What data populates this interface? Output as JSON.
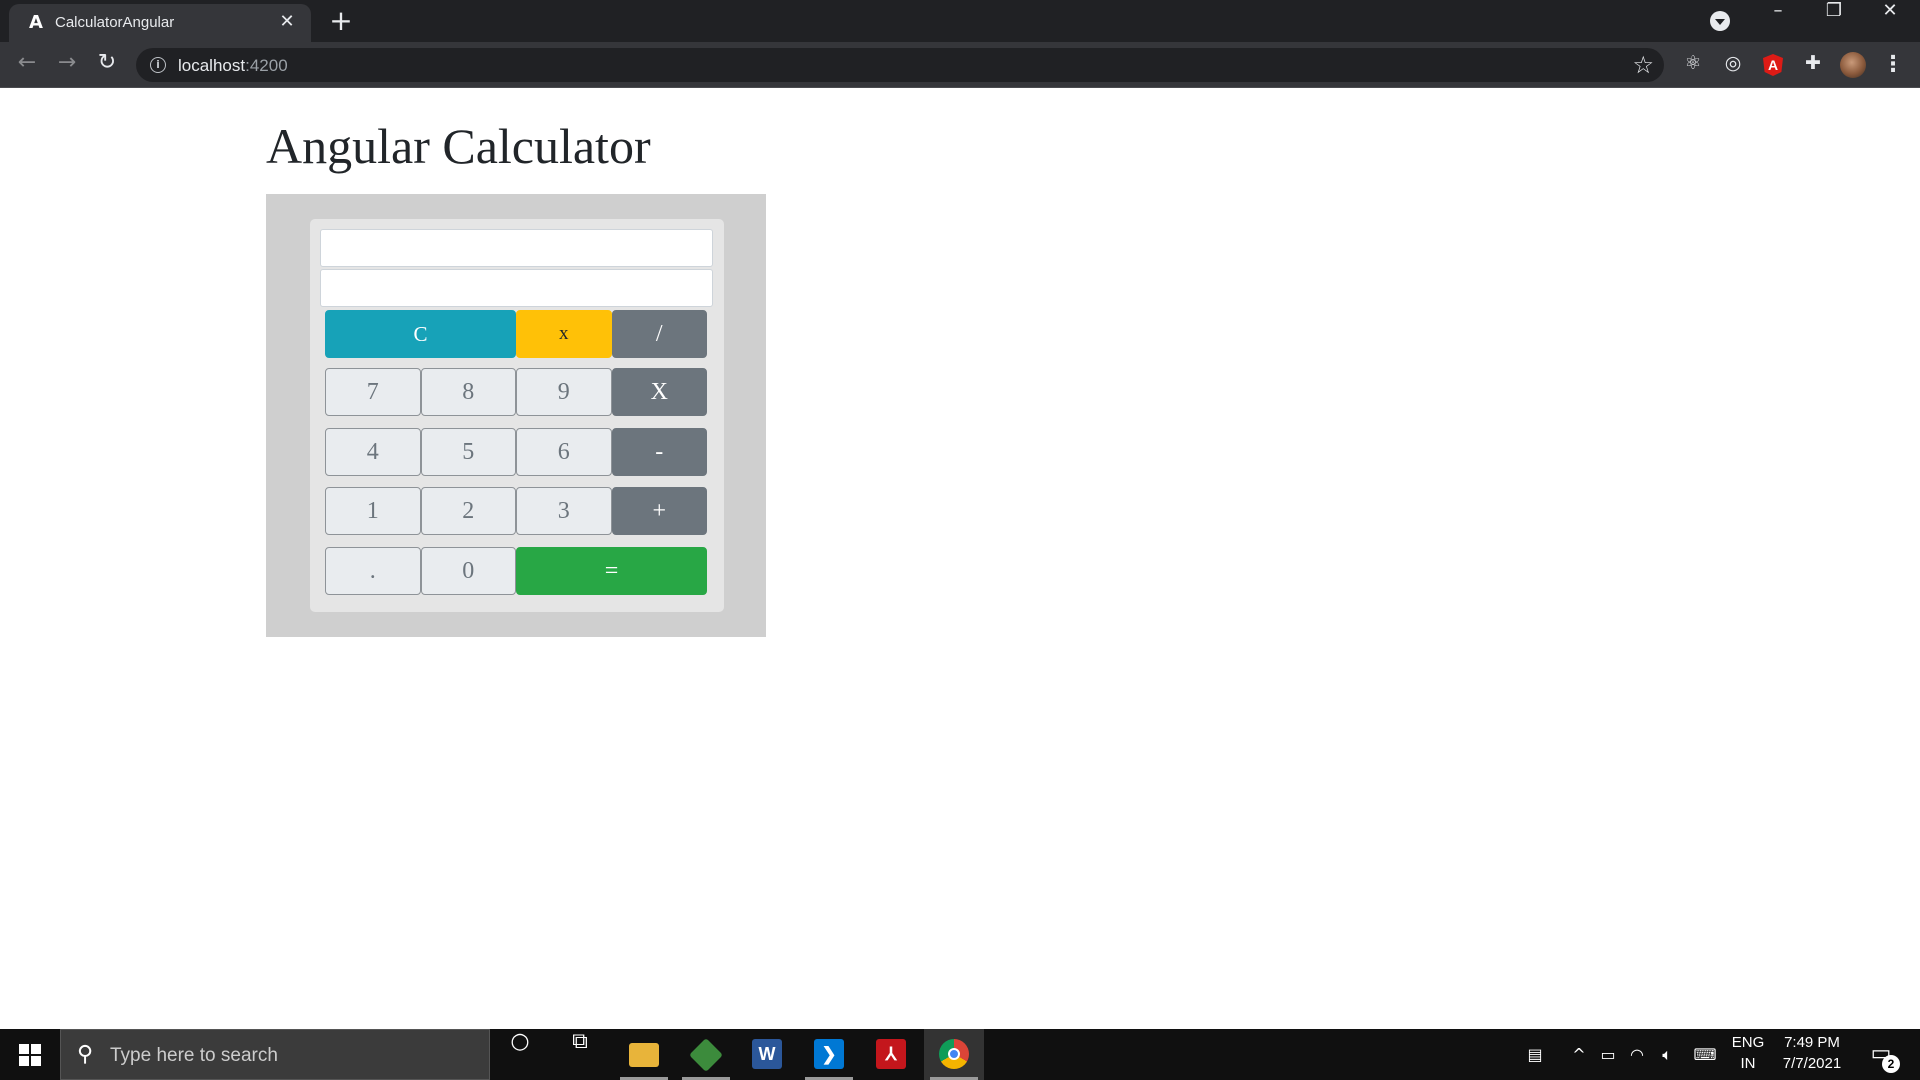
{
  "browser": {
    "tab_title": "CalculatorAngular",
    "tab_favicon": "angular-icon",
    "tab_close": "✕",
    "new_tab": "+",
    "url_host": "localhost",
    "url_port": ":4200",
    "window_controls": {
      "minimize": "–",
      "restore": "❐",
      "close": "✕"
    }
  },
  "page": {
    "title": "Angular Calculator",
    "display_primary": "",
    "display_secondary": ""
  },
  "calculator": {
    "rows": [
      [
        {
          "label": "C",
          "kind": "clear"
        },
        {
          "label": "x",
          "kind": "warn"
        },
        {
          "label": "/",
          "kind": "op"
        }
      ],
      [
        {
          "label": "7",
          "kind": "num"
        },
        {
          "label": "8",
          "kind": "num"
        },
        {
          "label": "9",
          "kind": "num"
        },
        {
          "label": "X",
          "kind": "op"
        }
      ],
      [
        {
          "label": "4",
          "kind": "num"
        },
        {
          "label": "5",
          "kind": "num"
        },
        {
          "label": "6",
          "kind": "num"
        },
        {
          "label": "-",
          "kind": "op"
        }
      ],
      [
        {
          "label": "1",
          "kind": "num"
        },
        {
          "label": "2",
          "kind": "num"
        },
        {
          "label": "3",
          "kind": "num"
        },
        {
          "label": "+",
          "kind": "op"
        }
      ],
      [
        {
          "label": ".",
          "kind": "num"
        },
        {
          "label": "0",
          "kind": "num"
        },
        {
          "label": "=",
          "kind": "eq"
        }
      ]
    ],
    "colors": {
      "clear": "#17a2b8",
      "warn": "#ffc107",
      "op": "#6c757d",
      "num": "#e9ecef",
      "eq": "#28a745"
    }
  },
  "taskbar": {
    "search_placeholder": "Type here to search",
    "apps": [
      "cortana-icon",
      "task-view-icon",
      "file-explorer-icon",
      "git-icon",
      "word-icon",
      "vscode-icon",
      "acrobat-icon",
      "chrome-icon"
    ],
    "language_line1": "ENG",
    "language_line2": "IN",
    "time": "7:49 PM",
    "date": "7/7/2021",
    "notification_count": "2"
  }
}
